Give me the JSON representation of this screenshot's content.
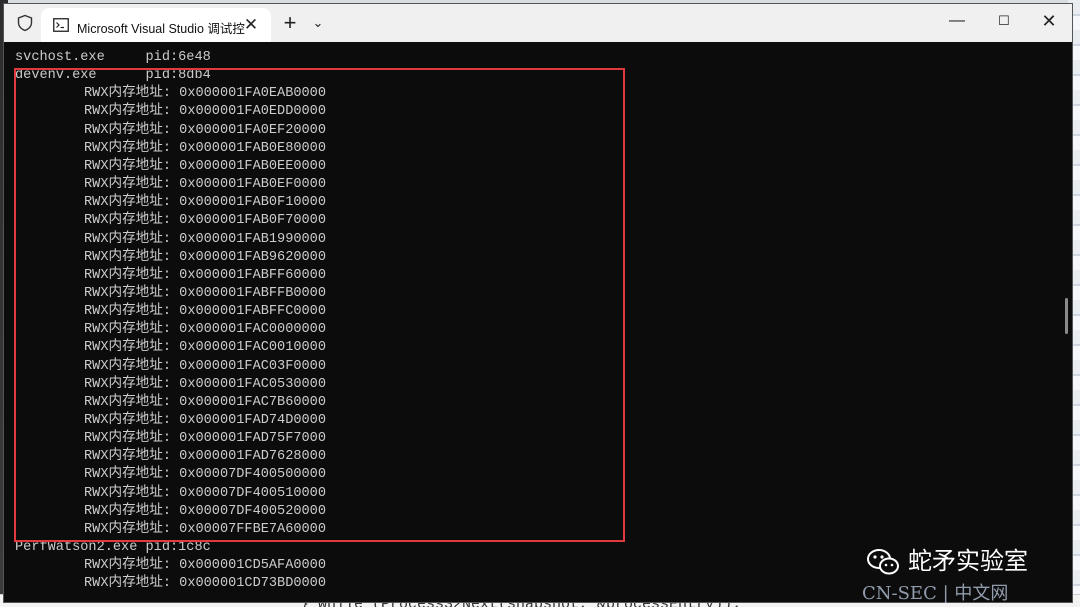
{
  "window": {
    "tab_title": "Microsoft Visual Studio 调试控",
    "tab_close": "✕",
    "new_tab": "+",
    "tab_dropdown": "⌄",
    "minimize": "—",
    "maximize": "☐",
    "close": "✕"
  },
  "console": {
    "lines": [
      {
        "text": "svchost.exe     pid:6e48",
        "indent": false
      },
      {
        "text": "devenv.exe      pid:8db4",
        "indent": false
      },
      {
        "text": "RWX内存地址: 0x000001FA0EAB0000",
        "indent": true
      },
      {
        "text": "RWX内存地址: 0x000001FA0EDD0000",
        "indent": true
      },
      {
        "text": "RWX内存地址: 0x000001FA0EF20000",
        "indent": true
      },
      {
        "text": "RWX内存地址: 0x000001FAB0E80000",
        "indent": true
      },
      {
        "text": "RWX内存地址: 0x000001FAB0EE0000",
        "indent": true
      },
      {
        "text": "RWX内存地址: 0x000001FAB0EF0000",
        "indent": true
      },
      {
        "text": "RWX内存地址: 0x000001FAB0F10000",
        "indent": true
      },
      {
        "text": "RWX内存地址: 0x000001FAB0F70000",
        "indent": true
      },
      {
        "text": "RWX内存地址: 0x000001FAB1990000",
        "indent": true
      },
      {
        "text": "RWX内存地址: 0x000001FAB9620000",
        "indent": true
      },
      {
        "text": "RWX内存地址: 0x000001FABFF60000",
        "indent": true
      },
      {
        "text": "RWX内存地址: 0x000001FABFFB0000",
        "indent": true
      },
      {
        "text": "RWX内存地址: 0x000001FABFFC0000",
        "indent": true
      },
      {
        "text": "RWX内存地址: 0x000001FAC0000000",
        "indent": true
      },
      {
        "text": "RWX内存地址: 0x000001FAC0010000",
        "indent": true
      },
      {
        "text": "RWX内存地址: 0x000001FAC03F0000",
        "indent": true
      },
      {
        "text": "RWX内存地址: 0x000001FAC0530000",
        "indent": true
      },
      {
        "text": "RWX内存地址: 0x000001FAC7B60000",
        "indent": true
      },
      {
        "text": "RWX内存地址: 0x000001FAD74D0000",
        "indent": true
      },
      {
        "text": "RWX内存地址: 0x000001FAD75F7000",
        "indent": true
      },
      {
        "text": "RWX内存地址: 0x000001FAD7628000",
        "indent": true
      },
      {
        "text": "RWX内存地址: 0x00007DF400500000",
        "indent": true
      },
      {
        "text": "RWX内存地址: 0x00007DF400510000",
        "indent": true
      },
      {
        "text": "RWX内存地址: 0x00007DF400520000",
        "indent": true
      },
      {
        "text": "RWX内存地址: 0x00007FFBE7A60000",
        "indent": true
      },
      {
        "text": "PerfWatson2.exe pid:1c8c",
        "indent": false
      },
      {
        "text": "RWX内存地址: 0x000001CD5AFA0000",
        "indent": true
      },
      {
        "text": "RWX内存地址: 0x000001CD73BD0000",
        "indent": true
      }
    ]
  },
  "background_code": "} while (Process32Next(snapshot, &processEntry));",
  "watermark": {
    "brand": "蛇矛实验室",
    "site": "CN-SEC | 中文网"
  },
  "colors": {
    "console_bg": "#0c0c0c",
    "console_text": "#cccccc",
    "highlight_box": "#e0393e",
    "titlebar": "#f0f0f0"
  }
}
